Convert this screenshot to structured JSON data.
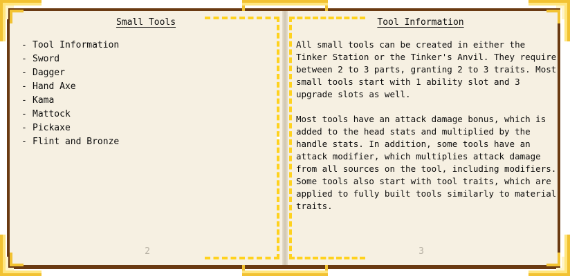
{
  "book": {
    "left_page": {
      "title": "Small Tools",
      "bullet": "-",
      "toc_items": [
        "Tool Information",
        "Sword",
        "Dagger",
        "Hand Axe",
        "Kama",
        "Mattock",
        "Pickaxe",
        "Flint and Bronze"
      ],
      "page_number": "2"
    },
    "right_page": {
      "title": "Tool Information",
      "paragraphs": [
        "All small tools can be created in either the Tinker Station or the Tinker's Anvil. They require between 2 to 3 parts, granting 2 to 3 traits. Most small tools start with 1 ability slot and 3 upgrade slots as well.",
        "Most tools have an attack damage bonus, which is added to the head stats and multiplied by the handle stats. In addition, some tools have an attack modifier, which multiplies attack damage from all sources on the tool, including modifiers. Some tools also start with tool traits, which are applied to fully built tools similarly to material traits."
      ],
      "page_number": "3"
    }
  },
  "colors": {
    "page": "#f6f0e2",
    "cover": "#6a3a12",
    "gold_trim": "#f2c232",
    "decor_bracket": "#ffd21e",
    "text": "#0d0d0d",
    "page_number": "#b7b1a4"
  }
}
